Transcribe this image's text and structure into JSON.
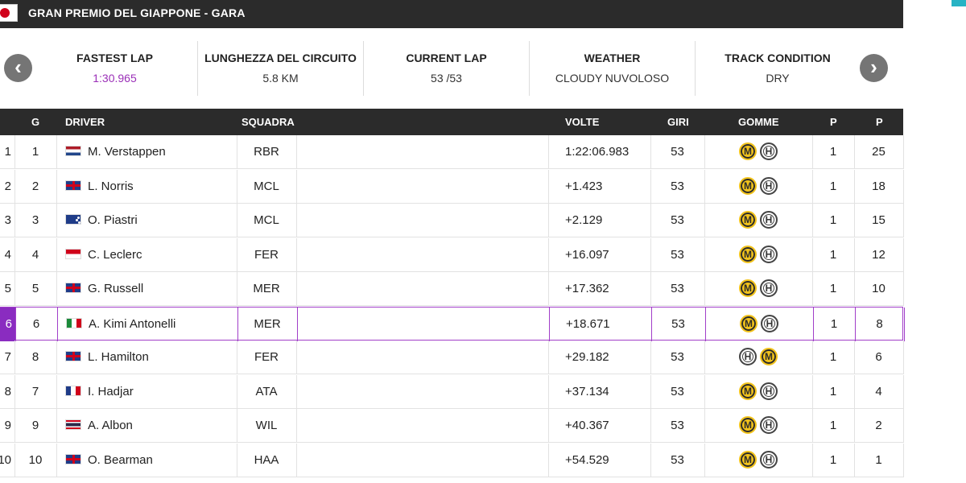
{
  "header": {
    "title": "GRAN PREMIO DEL GIAPPONE - GARA"
  },
  "colors": {
    "accent": "#9b30b8",
    "highlight_row": "#8a2cc0",
    "header_bg": "#2b2b2b",
    "nav_button": "#757575"
  },
  "info_bar": {
    "prev_icon": "chevron-left-icon",
    "next_icon": "chevron-right-icon",
    "prev_glyph": "‹",
    "next_glyph": "›",
    "fastest_lap": {
      "label": "FASTEST LAP",
      "value": "1:30.965"
    },
    "circuit_length": {
      "label": "LUNGHEZZA DEL CIRCUITO",
      "value": "5.8 KM"
    },
    "current_lap": {
      "label": "CURRENT LAP",
      "value": "53 /53"
    },
    "weather": {
      "label": "WEATHER",
      "value": "CLOUDY NUVOLOSO"
    },
    "track_condition": {
      "label": "TRACK CONDITION",
      "value": "DRY"
    }
  },
  "table": {
    "headers": {
      "grid": "G",
      "driver": "DRIVER",
      "team": "SQUADRA",
      "time": "VOLTE",
      "laps": "GIRI",
      "tyres": "GOMME",
      "pits": "P",
      "points": "P"
    },
    "rows": [
      {
        "pos": "1",
        "grid": "1",
        "flag": "nl",
        "driver": "M. Verstappen",
        "team": "RBR",
        "time": "1:22:06.983",
        "laps": "53",
        "tyres": [
          "M",
          "H"
        ],
        "pits": "1",
        "points": "25"
      },
      {
        "pos": "2",
        "grid": "2",
        "flag": "gb",
        "driver": "L. Norris",
        "team": "MCL",
        "time": "+1.423",
        "laps": "53",
        "tyres": [
          "M",
          "H"
        ],
        "pits": "1",
        "points": "18"
      },
      {
        "pos": "3",
        "grid": "3",
        "flag": "au",
        "driver": "O. Piastri",
        "team": "MCL",
        "time": "+2.129",
        "laps": "53",
        "tyres": [
          "M",
          "H"
        ],
        "pits": "1",
        "points": "15"
      },
      {
        "pos": "4",
        "grid": "4",
        "flag": "mc",
        "driver": "C. Leclerc",
        "team": "FER",
        "time": "+16.097",
        "laps": "53",
        "tyres": [
          "M",
          "H"
        ],
        "pits": "1",
        "points": "12"
      },
      {
        "pos": "5",
        "grid": "5",
        "flag": "gb",
        "driver": "G. Russell",
        "team": "MER",
        "time": "+17.362",
        "laps": "53",
        "tyres": [
          "M",
          "H"
        ],
        "pits": "1",
        "points": "10"
      },
      {
        "pos": "6",
        "grid": "6",
        "flag": "it",
        "driver": "A. Kimi Antonelli",
        "team": "MER",
        "time": "+18.671",
        "laps": "53",
        "tyres": [
          "M",
          "H"
        ],
        "pits": "1",
        "points": "8",
        "highlighted": true
      },
      {
        "pos": "7",
        "grid": "8",
        "flag": "gb",
        "driver": "L. Hamilton",
        "team": "FER",
        "time": "+29.182",
        "laps": "53",
        "tyres": [
          "H",
          "M"
        ],
        "pits": "1",
        "points": "6"
      },
      {
        "pos": "8",
        "grid": "7",
        "flag": "fr",
        "driver": "I. Hadjar",
        "team": "ATA",
        "time": "+37.134",
        "laps": "53",
        "tyres": [
          "M",
          "H"
        ],
        "pits": "1",
        "points": "4"
      },
      {
        "pos": "9",
        "grid": "9",
        "flag": "th",
        "driver": "A. Albon",
        "team": "WIL",
        "time": "+40.367",
        "laps": "53",
        "tyres": [
          "M",
          "H"
        ],
        "pits": "1",
        "points": "2"
      },
      {
        "pos": "10",
        "grid": "10",
        "flag": "gb",
        "driver": "O. Bearman",
        "team": "HAA",
        "time": "+54.529",
        "laps": "53",
        "tyres": [
          "M",
          "H"
        ],
        "pits": "1",
        "points": "1"
      }
    ]
  }
}
